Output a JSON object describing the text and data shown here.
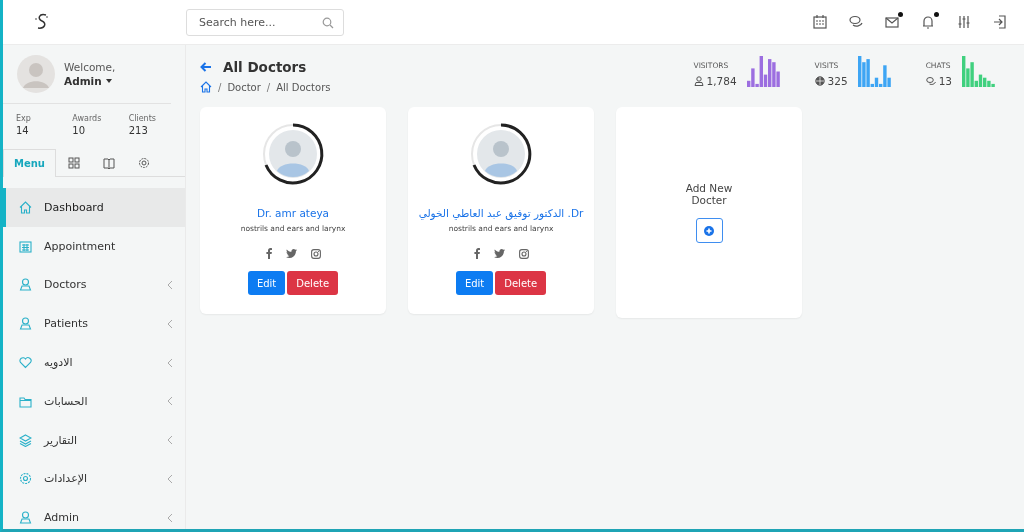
{
  "search": {
    "placeholder": "Search here..."
  },
  "header_icons": [
    {
      "kind": "calendar",
      "dot": false
    },
    {
      "kind": "chat",
      "dot": false
    },
    {
      "kind": "mail",
      "dot": true
    },
    {
      "kind": "bell",
      "dot": true
    },
    {
      "kind": "sliders",
      "dot": false
    },
    {
      "kind": "logout",
      "dot": false
    }
  ],
  "user": {
    "greeting": "Welcome,",
    "name": "Admin"
  },
  "user_stats": [
    {
      "label": "Exp",
      "value": "14"
    },
    {
      "label": "Awards",
      "value": "10"
    },
    {
      "label": "Clients",
      "value": "213"
    }
  ],
  "sidebar_tabs": [
    {
      "kind": "text",
      "label": "Menu",
      "selected": true
    },
    {
      "kind": "grid",
      "selected": false
    },
    {
      "kind": "book",
      "selected": false
    },
    {
      "kind": "gear",
      "selected": false
    }
  ],
  "menu": [
    {
      "label": "Dashboard",
      "selected": true,
      "has_submenu": false
    },
    {
      "label": "Appointment",
      "selected": false,
      "has_submenu": false
    },
    {
      "label": "Doctors",
      "selected": false,
      "has_submenu": true
    },
    {
      "label": "Patients",
      "selected": false,
      "has_submenu": true
    },
    {
      "label": "الادويه",
      "selected": false,
      "has_submenu": true
    },
    {
      "label": "الحسابات",
      "selected": false,
      "has_submenu": true
    },
    {
      "label": "التقارير",
      "selected": false,
      "has_submenu": true
    },
    {
      "label": "الإعدادات",
      "selected": false,
      "has_submenu": true
    },
    {
      "label": "Admin",
      "selected": false,
      "has_submenu": true
    }
  ],
  "page": {
    "title": "All Doctors",
    "breadcrumb_separator": "/",
    "breadcrumb": [
      "Doctor",
      "All Doctors"
    ]
  },
  "stats": [
    {
      "label": "VISITORS",
      "value": "1,784",
      "color": "#9c6ee0"
    },
    {
      "label": "VISITS",
      "value": "325",
      "color": "#3da5f4"
    },
    {
      "label": "CHATS",
      "value": "13",
      "color": "#3fd07e"
    }
  ],
  "doctors": [
    {
      "name": "Dr. amr ateya",
      "specialty": "nostrils and ears and larynx",
      "edit": "Edit",
      "delete": "Delete"
    },
    {
      "name": "الدكتور توفيق عبد العاطي الخولي .Dr",
      "specialty": "nostrils and ears and larynx",
      "edit": "Edit",
      "delete": "Delete"
    }
  ],
  "add_card": {
    "title": "Add New Docter"
  }
}
